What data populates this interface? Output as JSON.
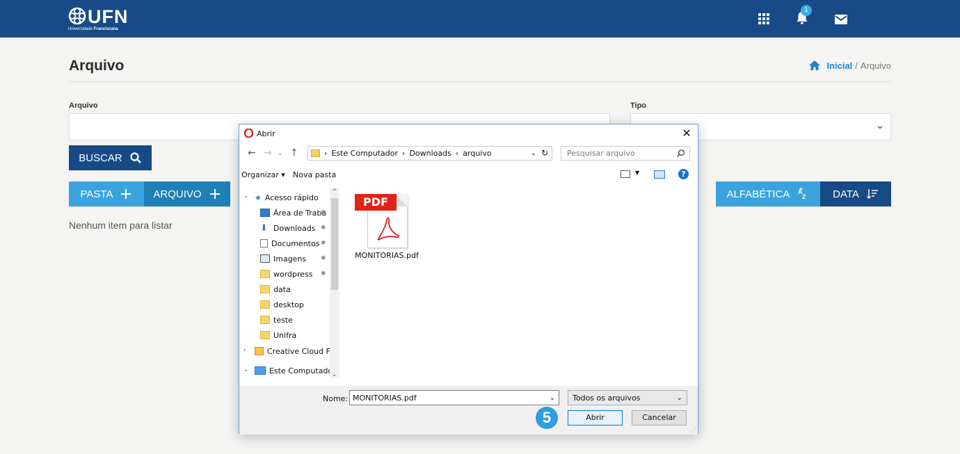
{
  "header": {
    "logo_text": "UFN",
    "logo_sub_prefix": "Universidade",
    "logo_sub_brand": "Franciscana",
    "notification_count": "1",
    "icons": [
      "apps-grid-icon",
      "bell-icon",
      "mail-icon"
    ]
  },
  "page": {
    "title": "Arquivo",
    "breadcrumb": {
      "home_label": "Inicial",
      "separator": "/",
      "current": "Arquivo"
    }
  },
  "filters": {
    "arquivo_label": "Arquivo",
    "arquivo_value": "",
    "tipo_label": "Tipo",
    "tipo_value": ""
  },
  "buttons": {
    "buscar": "BUSCAR",
    "pasta": "PASTA",
    "arquivo": "ARQUIVO",
    "alfabetica": "ALFABÉTICA",
    "data": "DATA"
  },
  "empty_message": "Nenhum item para listar",
  "dialog": {
    "title": "Abrir",
    "path": [
      "Este Computador",
      "Downloads",
      "arquivo"
    ],
    "search_placeholder": "Pesquisar arquivo",
    "toolbar": {
      "organizar": "Organizar",
      "nova_pasta": "Nova pasta"
    },
    "nav": {
      "quick_access": "Acesso rápido",
      "items": [
        {
          "label": "Área de Traba",
          "icon": "desktop-folder-icon",
          "pinned": true
        },
        {
          "label": "Downloads",
          "icon": "downloads-icon",
          "pinned": true
        },
        {
          "label": "Documentos",
          "icon": "documents-icon",
          "pinned": true
        },
        {
          "label": "Imagens",
          "icon": "images-icon",
          "pinned": true
        },
        {
          "label": "wordpress",
          "icon": "folder-icon",
          "pinned": true
        },
        {
          "label": "data",
          "icon": "folder-icon",
          "pinned": false
        },
        {
          "label": "desktop",
          "icon": "folder-icon",
          "pinned": false
        },
        {
          "label": "teste",
          "icon": "folder-icon",
          "pinned": false
        },
        {
          "label": "Unifra",
          "icon": "folder-icon",
          "pinned": false
        }
      ],
      "creative_cloud": "Creative Cloud Fil",
      "este_computador": "Este Computador"
    },
    "files": [
      {
        "name": "MONITORIAS.pdf",
        "badge": "PDF",
        "icon": "pdf-file-icon"
      }
    ],
    "name_label": "Nome:",
    "name_value": "MONITORIAS.pdf",
    "file_type": "Todos os arquivos",
    "open_button": "Abrir",
    "cancel_button": "Cancelar",
    "step_badge": "5"
  },
  "colors": {
    "navbar": "#174a86",
    "accent": "#3aa3dd",
    "link": "#1f86c8"
  }
}
